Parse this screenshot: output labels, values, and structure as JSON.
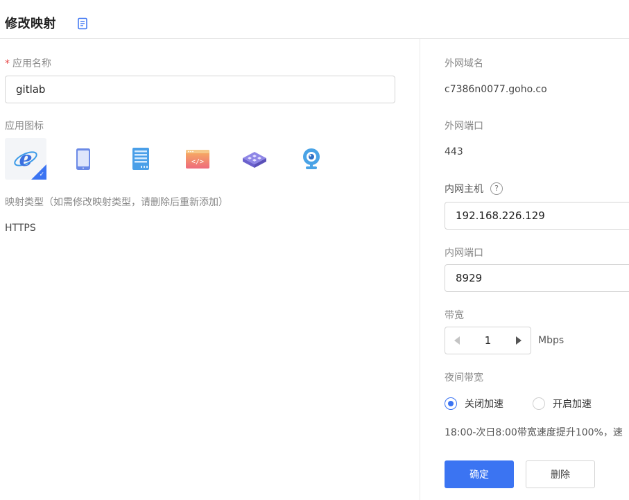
{
  "header": {
    "title": "修改映射",
    "doc_icon": "document-icon"
  },
  "left": {
    "app_name_label": "应用名称",
    "app_name_value": "gitlab",
    "app_icon_label": "应用图标",
    "icons": [
      "ie-icon",
      "tablet-icon",
      "server-icon",
      "code-window-icon",
      "router-icon",
      "webcam-icon"
    ],
    "selected_icon_index": 0,
    "mapping_type_label": "映射类型（如需修改映射类型，请删除后重新添加）",
    "mapping_type_value": "HTTPS"
  },
  "right": {
    "domain_label": "外网域名",
    "domain_value": "c7386n0077.goho.co",
    "ext_port_label": "外网端口",
    "ext_port_value": "443",
    "int_host_label": "内网主机",
    "int_host_help": "?",
    "int_host_value": "192.168.226.129",
    "int_port_label": "内网端口",
    "int_port_value": "8929",
    "bandwidth_label": "带宽",
    "bandwidth_value": "1",
    "bandwidth_unit": "Mbps",
    "night_label": "夜间带宽",
    "radio_off_label": "关闭加速",
    "radio_on_label": "开启加速",
    "night_selected": "off",
    "night_note": "18:00-次日8:00带宽速度提升100%，速"
  },
  "buttons": {
    "confirm": "确定",
    "delete": "删除"
  },
  "colors": {
    "primary": "#3b74f2",
    "required": "#e64646"
  }
}
